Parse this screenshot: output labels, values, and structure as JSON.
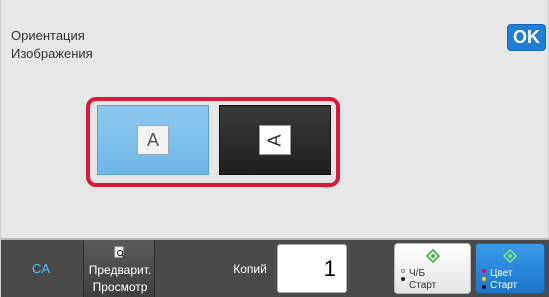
{
  "header": {
    "title_line1": "Ориентация",
    "title_line2": "Изображения",
    "ok_label": "OK"
  },
  "orientation": {
    "options": [
      {
        "name": "portrait",
        "glyph": "A",
        "selected": true
      },
      {
        "name": "landscape",
        "glyph": "A",
        "selected": false
      }
    ]
  },
  "bottom_bar": {
    "ca_label": "CA",
    "preview_line1": "Предварит.",
    "preview_line2": "Просмотр",
    "copies_label": "Копий",
    "copies_value": "1",
    "start_bw_line1": "Ч/Б",
    "start_bw_line2": "Старт",
    "start_color_line1": "Цвет",
    "start_color_line2": "Старт"
  },
  "colors": {
    "accent_blue": "#1f7ed6",
    "selection_red": "#d81a3a",
    "selected_option": "#8ec9ef",
    "start_green": "#3cb043"
  },
  "icons": {
    "preview": "magnifier-document-icon",
    "start": "diamond-start-icon"
  }
}
